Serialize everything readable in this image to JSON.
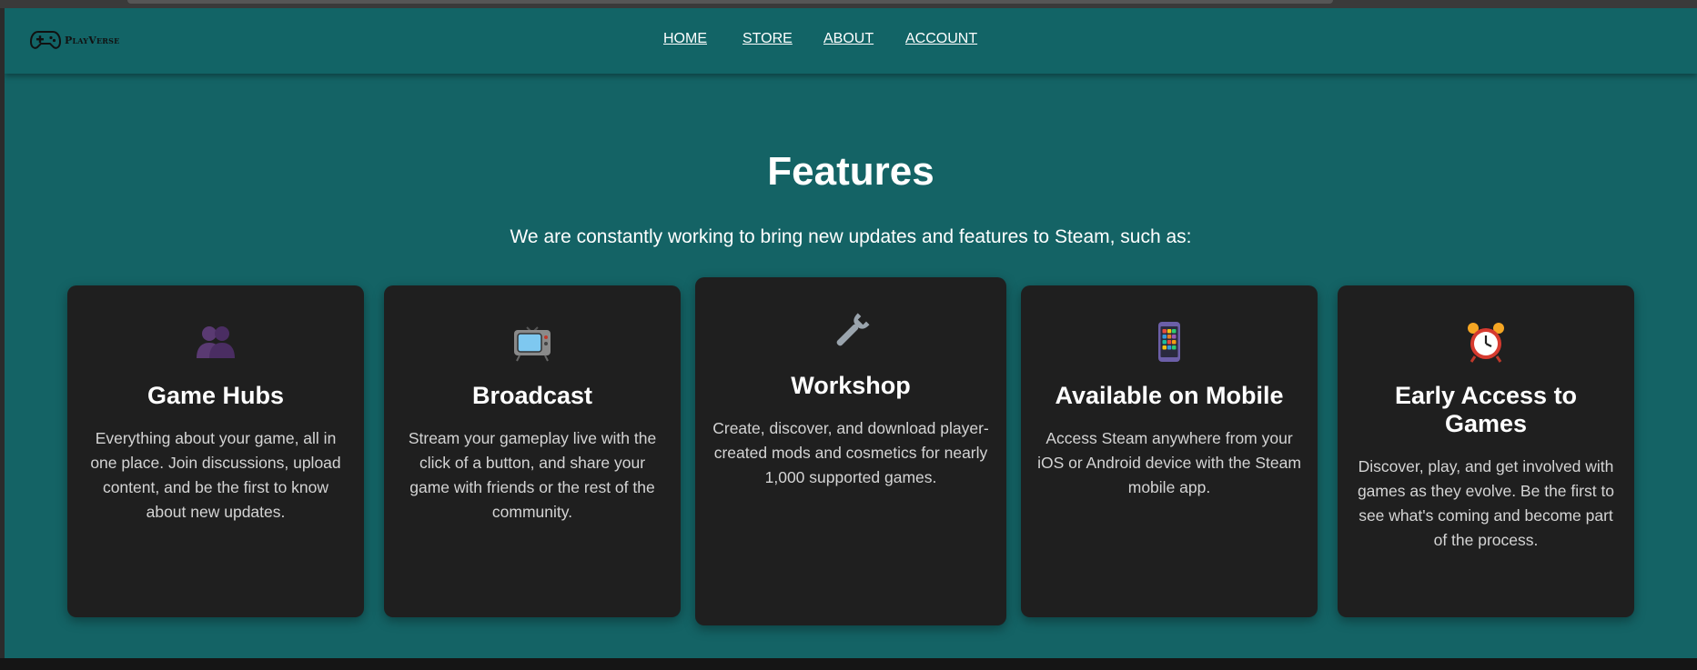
{
  "header": {
    "logo_text": "PlayVerse",
    "nav": [
      "HOME",
      "STORE",
      "ABOUT",
      "ACCOUNT"
    ]
  },
  "features": {
    "title": "Features",
    "subtitle": "We are constantly working to bring new updates and features to Steam, such as:",
    "cards": [
      {
        "icon": "two-people-silhouette-icon",
        "title": "Game Hubs",
        "description": "Everything about your game, all in one place. Join discussions, upload content, and be the first to know about new updates."
      },
      {
        "icon": "television-icon",
        "title": "Broadcast",
        "description": "Stream your gameplay live with the click of a button, and share your game with friends or the rest of the community."
      },
      {
        "icon": "wrench-icon",
        "title": "Workshop",
        "description": "Create, discover, and download player-created mods and cosmetics for nearly 1,000 supported games."
      },
      {
        "icon": "mobile-phone-icon",
        "title": "Available on Mobile",
        "description": "Access Steam anywhere from your iOS or Android device with the Steam mobile app."
      },
      {
        "icon": "alarm-clock-icon",
        "title": "Early Access to Games",
        "description": "Discover, play, and get involved with games as they evolve. Be the first to see what's coming and become part of the process."
      }
    ]
  },
  "colors": {
    "page_background": "#146365",
    "navbar_background": "#126466",
    "card_background": "#1f1f1f",
    "heading_text": "#ffffff",
    "body_text": "#d4d4d4"
  }
}
